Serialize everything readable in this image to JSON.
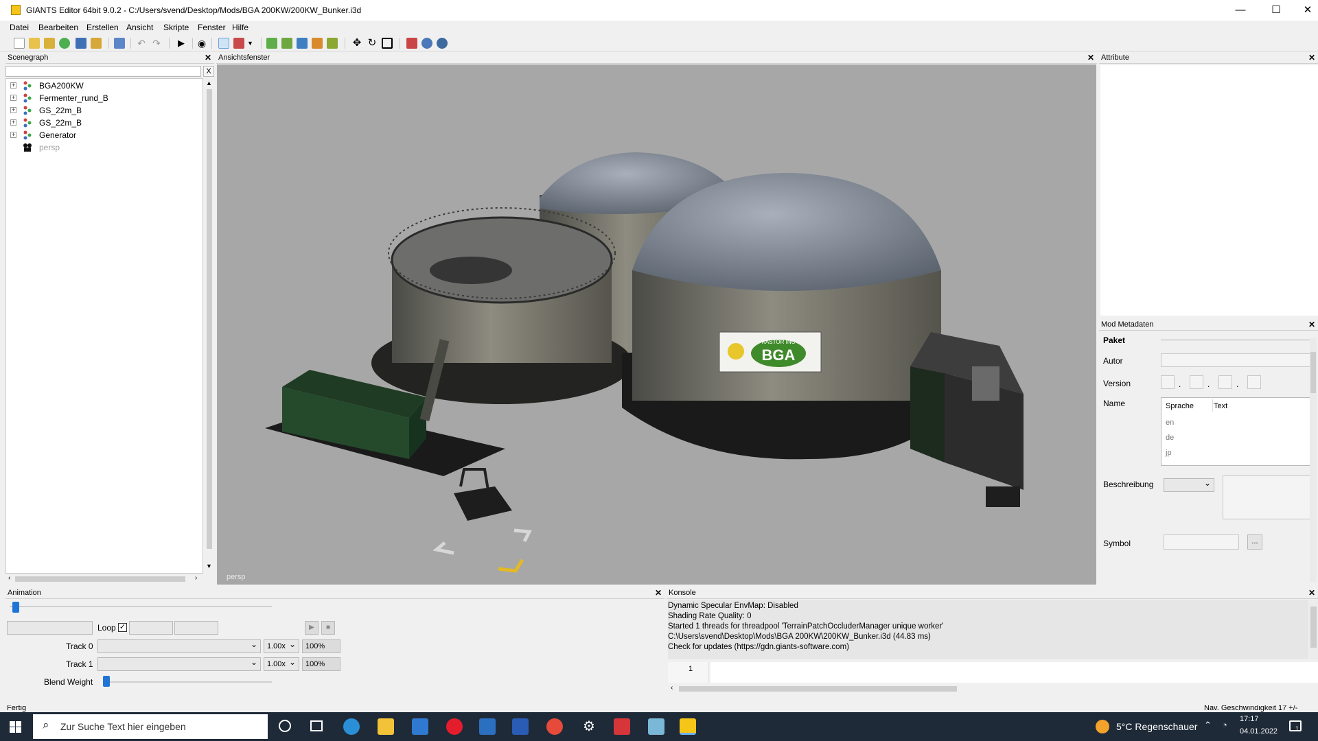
{
  "window": {
    "title": "GIANTS Editor 64bit 9.0.2 - C:/Users/svend/Desktop/Mods/BGA 200KW/200KW_Bunker.i3d",
    "minimize": "—",
    "maximize": "☐",
    "close": "✕"
  },
  "menu": [
    "Datei",
    "Bearbeiten",
    "Erstellen",
    "Ansicht",
    "Skripte",
    "Fenster",
    "Hilfe"
  ],
  "scenegraph": {
    "title": "Scenegraph",
    "filter_clear": "X",
    "items": [
      {
        "label": "BGA200KW",
        "expander": "+"
      },
      {
        "label": "Fermenter_rund_B",
        "expander": "+"
      },
      {
        "label": "GS_22m_B",
        "expander": "+"
      },
      {
        "label": "GS_22m_B",
        "expander": "+"
      },
      {
        "label": "Generator",
        "expander": "+"
      },
      {
        "label": "persp",
        "expander": ""
      }
    ]
  },
  "viewport": {
    "title": "Ansichtsfenster",
    "camera_label": "persp",
    "sign_top": "KASTOR INC",
    "sign_main": "BGA"
  },
  "attribute": {
    "title": "Attribute",
    "mod_title": "Mod Metadaten",
    "paket": "Paket",
    "autor": "Autor",
    "version": "Version",
    "version_dot": ".",
    "name": "Name",
    "col_sprache": "Sprache",
    "col_text": "Text",
    "langs": [
      "en",
      "de",
      "jp"
    ],
    "beschreibung": "Beschreibung",
    "symbol": "Symbol",
    "symbol_btn": "..."
  },
  "animation": {
    "title": "Animation",
    "loop_label": "Loop",
    "loop_checked": true,
    "track0": "Track 0",
    "track1": "Track 1",
    "speed0": "1.00x",
    "speed1": "1.00x",
    "pct0": "100%",
    "pct1": "100%",
    "blend_label": "Blend Weight"
  },
  "console": {
    "title": "Konsole",
    "lines": [
      " Dynamic Specular EnvMap: Disabled",
      "  Shading Rate Quality: 0",
      "Started 1 threads for threadpool 'TerrainPatchOccluderManager unique worker'",
      "C:\\Users\\svend\\Desktop\\Mods\\BGA 200KW\\200KW_Bunker.i3d (44.83 ms)",
      "Check for updates (https://gdn.giants-software.com)"
    ],
    "line_number": "1"
  },
  "status": {
    "left": "Fertig",
    "right": "Nav. Geschwindigkeit 17 +/-"
  },
  "taskbar": {
    "search_placeholder": "Zur Suche Text hier eingeben",
    "weather": "5°C  Regenschauer",
    "time": "17:17",
    "date": "04.01.2022",
    "notification_count": "1"
  }
}
